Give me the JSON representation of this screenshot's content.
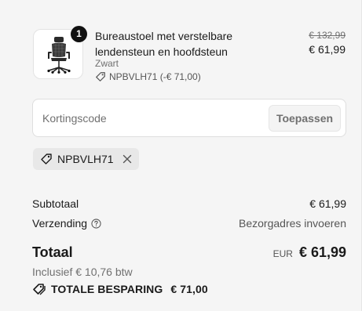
{
  "product": {
    "quantity": "1",
    "name": "Bureaustoel met verstelbare lendensteun en hoofdsteun",
    "variant": "Zwart",
    "discount_tag": "NPBVLH71 (-€ 71,00)",
    "original_price": "€ 132,99",
    "price": "€ 61,99",
    "image_icon": "office-chair-icon"
  },
  "discount": {
    "placeholder": "Kortingscode",
    "apply_label": "Toepassen"
  },
  "applied_code": {
    "code": "NPBVLH71",
    "tag_icon": "tag-icon",
    "remove_icon": "close-icon"
  },
  "summary": {
    "subtotal_label": "Subtotaal",
    "subtotal_value": "€ 61,99",
    "shipping_label": "Verzending",
    "shipping_value": "Bezorgadres invoeren",
    "total_label": "Totaal",
    "currency": "EUR",
    "total_value": "€ 61,99",
    "tax_note": "Inclusief € 10,76 btw",
    "savings_label": "TOTALE BESPARING",
    "savings_value": "€ 71,00"
  }
}
